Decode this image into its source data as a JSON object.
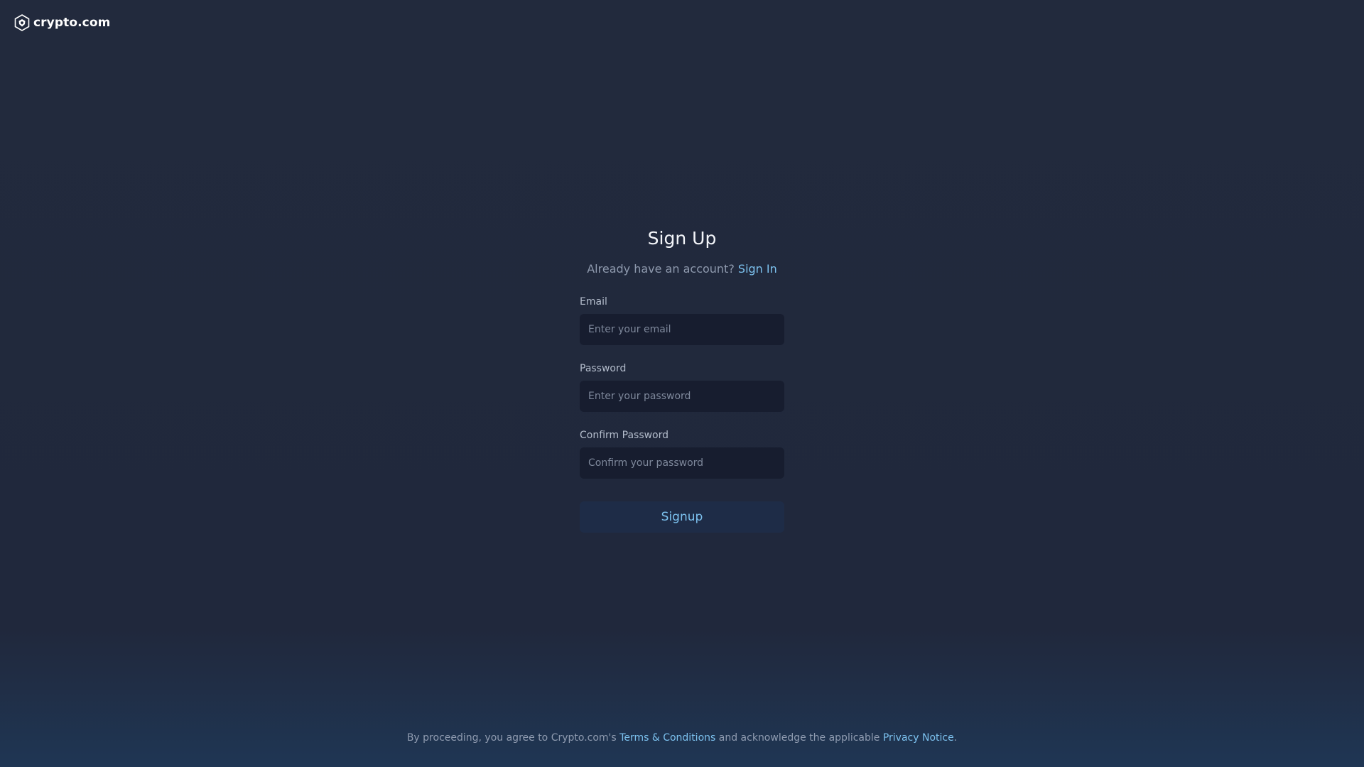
{
  "brand": {
    "name": "crypto.com",
    "icon": "crypto-com-lion-shield-icon"
  },
  "form": {
    "title": "Sign Up",
    "subtitle_text": "Already have an account?",
    "signin_link": "Sign In",
    "email": {
      "label": "Email",
      "placeholder": "Enter your email",
      "value": ""
    },
    "password": {
      "label": "Password",
      "placeholder": "Enter your password",
      "value": ""
    },
    "confirm_password": {
      "label": "Confirm Password",
      "placeholder": "Confirm your password",
      "value": ""
    },
    "submit_label": "Signup"
  },
  "footer": {
    "prefix": "By proceeding, you agree to Crypto.com's",
    "terms_link": "Terms & Conditions",
    "middle": "and acknowledge the applicable",
    "privacy_link": "Privacy Notice",
    "suffix": "."
  },
  "colors": {
    "background": "#222a3d",
    "accent_link": "#7cc1ee",
    "input_bg": "#171d2f",
    "button_bg": "#1e2c47"
  }
}
